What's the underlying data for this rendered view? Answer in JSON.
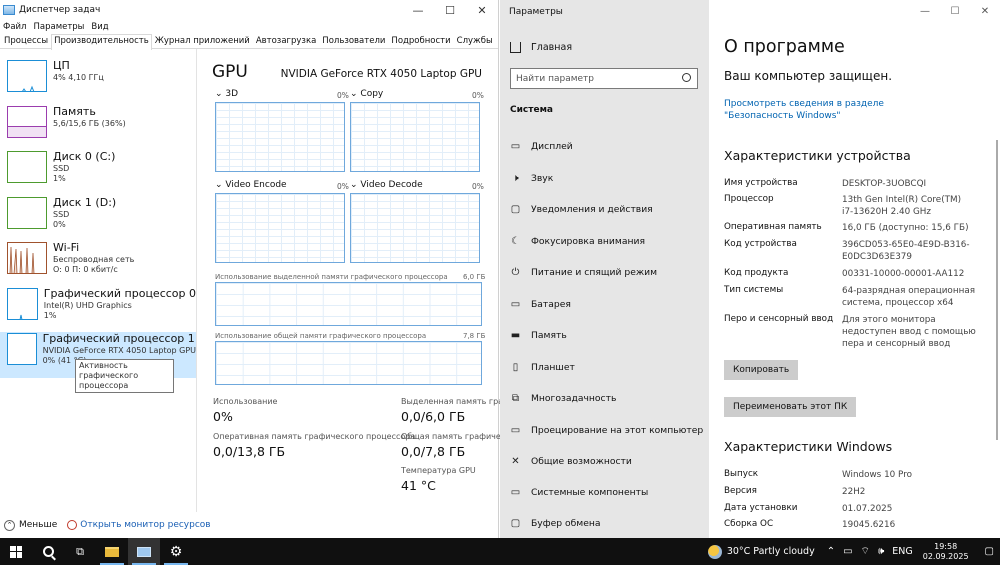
{
  "task_manager": {
    "title": "Диспетчер задач",
    "menu": [
      "Файл",
      "Параметры",
      "Вид"
    ],
    "tabs": [
      "Процессы",
      "Производительность",
      "Журнал приложений",
      "Автозагрузка",
      "Пользователи",
      "Подробности",
      "Службы"
    ],
    "active_tab": 1,
    "resources": [
      {
        "name": "ЦП",
        "sub1": "4% 4,10 ГГц",
        "sub2": "",
        "sub3": "",
        "color": "#1b8ed6"
      },
      {
        "name": "Память",
        "sub1": "5,6/15,6 ГБ (36%)",
        "sub2": "",
        "sub3": "",
        "color": "#9b3dae"
      },
      {
        "name": "Диск 0 (C:)",
        "sub1": "SSD",
        "sub2": "1%",
        "sub3": "",
        "color": "#4d9b2e"
      },
      {
        "name": "Диск 1 (D:)",
        "sub1": "SSD",
        "sub2": "0%",
        "sub3": "",
        "color": "#4d9b2e"
      },
      {
        "name": "Wi-Fi",
        "sub1": "Беспроводная сеть",
        "sub2": "О: 0 П: 0 кбит/с",
        "sub3": "",
        "color": "#a0522d"
      },
      {
        "name": "Графический процессор 0",
        "sub1": "Intel(R) UHD Graphics",
        "sub2": "1%",
        "sub3": "",
        "color": "#1b8ed6"
      },
      {
        "name": "Графический процессор 1",
        "sub1": "NVIDIA GeForce RTX 4050 Laptop GPU",
        "sub2": "0% (41 °C)",
        "sub3": "",
        "color": "#1b8ed6"
      }
    ],
    "tooltip": "Активность графического процессора",
    "gpu_title": "GPU",
    "gpu_name": "NVIDIA GeForce RTX 4050 Laptop GPU",
    "engines": [
      {
        "label": "3D",
        "pct": "0%"
      },
      {
        "label": "Copy",
        "pct": "0%"
      },
      {
        "label": "Video Encode",
        "pct": "0%"
      },
      {
        "label": "Video Decode",
        "pct": "0%"
      }
    ],
    "dedicated_mem_label": "Использование выделенной памяти графического процессора",
    "dedicated_mem_max": "6,0 ГБ",
    "shared_mem_label": "Использование общей памяти графического процессора",
    "shared_mem_max": "7,8 ГБ",
    "stats": {
      "usage_label": "Использование",
      "usage_value": "0%",
      "dedicated_label": "Выделенная память графического процессора",
      "dedicated_value": "0,0/6,0 ГБ",
      "gpu_mem_label": "Оперативная память графического процессора",
      "gpu_mem_value": "0,0/13,8 ГБ",
      "shared_label": "Общая память графического процессора",
      "shared_value": "0,0/7,8 ГБ",
      "temp_label": "Температура GPU",
      "temp_value": "41 °C"
    },
    "footer": {
      "less": "Меньше",
      "monitor": "Открыть монитор ресурсов"
    }
  },
  "settings": {
    "title": "Параметры",
    "home": "Главная",
    "search_placeholder": "Найти параметр",
    "section": "Система",
    "nav": [
      {
        "label": "Дисплей",
        "icon": "display-icon"
      },
      {
        "label": "Звук",
        "icon": "sound-icon"
      },
      {
        "label": "Уведомления и действия",
        "icon": "notifications-icon"
      },
      {
        "label": "Фокусировка внимания",
        "icon": "focus-assist-icon"
      },
      {
        "label": "Питание и спящий режим",
        "icon": "power-icon"
      },
      {
        "label": "Батарея",
        "icon": "battery-icon"
      },
      {
        "label": "Память",
        "icon": "storage-icon"
      },
      {
        "label": "Планшет",
        "icon": "tablet-icon"
      },
      {
        "label": "Многозадачность",
        "icon": "multitasking-icon"
      },
      {
        "label": "Проецирование на этот компьютер",
        "icon": "projecting-icon"
      },
      {
        "label": "Общие возможности",
        "icon": "shared-experiences-icon"
      },
      {
        "label": "Системные компоненты",
        "icon": "system-components-icon"
      },
      {
        "label": "Буфер обмена",
        "icon": "clipboard-icon"
      }
    ],
    "page_title": "О программе",
    "protected": "Ваш компьютер защищен.",
    "security_link": "Просмотреть сведения в разделе \"Безопасность Windows\"",
    "device_specs_title": "Характеристики устройства",
    "device_specs": [
      {
        "k": "Имя устройства",
        "v": "DESKTOP-3UOBCQI"
      },
      {
        "k": "Процессор",
        "v": "13th Gen Intel(R) Core(TM) i7-13620H   2.40 GHz"
      },
      {
        "k": "Оперативная память",
        "v": "16,0 ГБ (доступно: 15,6 ГБ)"
      },
      {
        "k": "Код устройства",
        "v": "396CD053-65E0-4E9D-B316-E0DC3D63E379"
      },
      {
        "k": "Код продукта",
        "v": "00331-10000-00001-AA112"
      },
      {
        "k": "Тип системы",
        "v": "64-разрядная операционная система, процессор x64"
      },
      {
        "k": "Перо и сенсорный ввод",
        "v": "Для этого монитора недоступен ввод с помощью пера и сенсорный ввод"
      }
    ],
    "copy_button": "Копировать",
    "rename_button": "Переименовать этот ПК",
    "windows_specs_title": "Характеристики Windows",
    "windows_specs": [
      {
        "k": "Выпуск",
        "v": "Windows 10 Pro"
      },
      {
        "k": "Версия",
        "v": "22H2"
      },
      {
        "k": "Дата установки",
        "v": "01.07.2025"
      },
      {
        "k": "Сборка ОС",
        "v": "19045.6216"
      }
    ]
  },
  "taskbar": {
    "weather": "30°C  Partly cloudy",
    "lang": "ENG",
    "time": "19:58",
    "date": "02.09.2025"
  }
}
